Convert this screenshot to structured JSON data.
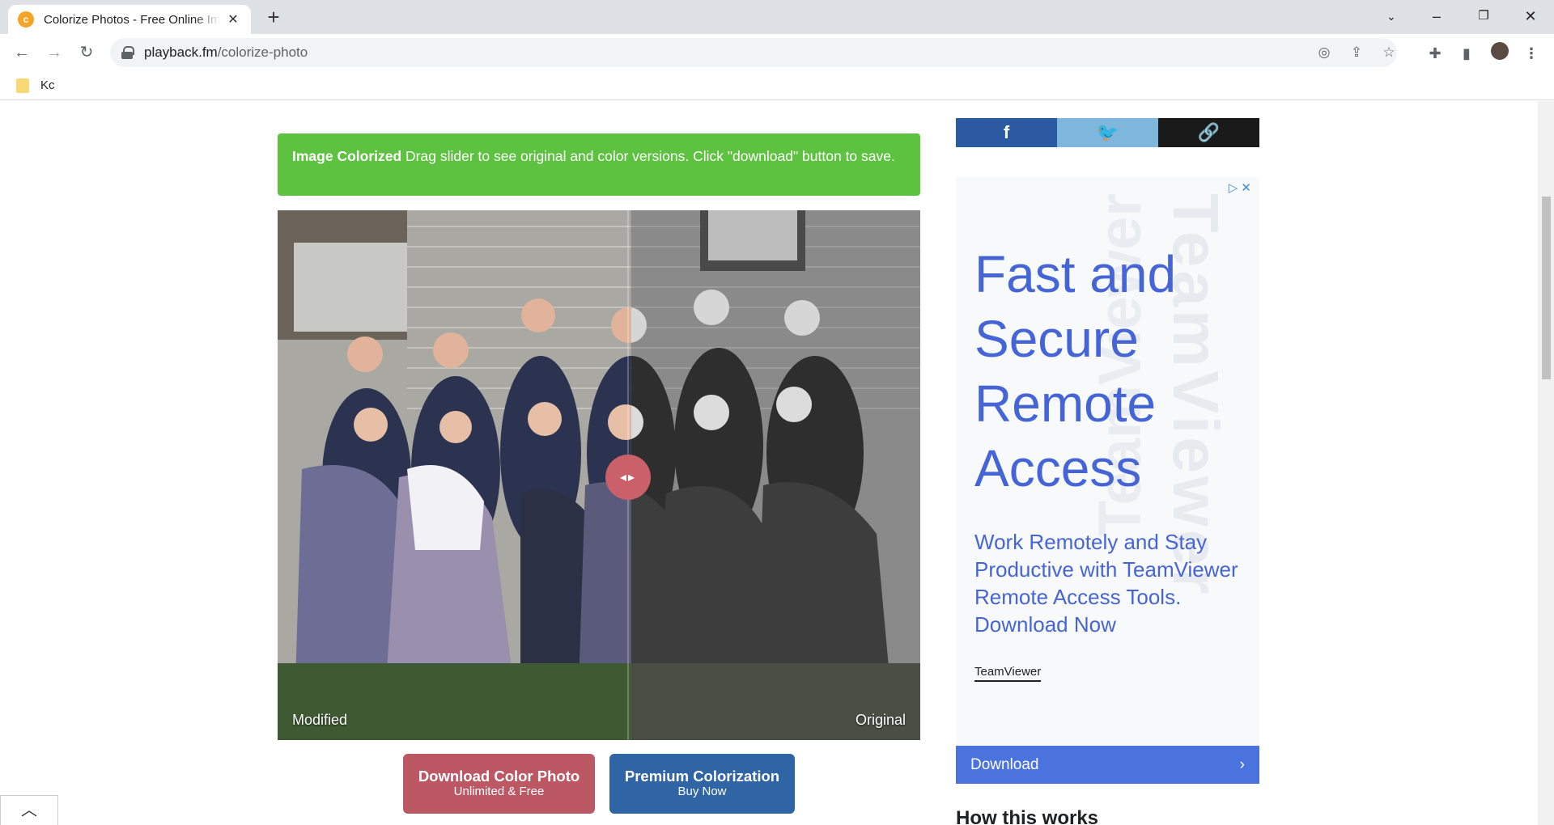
{
  "browser": {
    "tab_title": "Colorize Photos - Free Online Image Colorizer",
    "tab_favicon_glyph": "c",
    "url_host": "playback.fm",
    "url_path": "/colorize-photo",
    "bookmark_folder": "Kc"
  },
  "alert": {
    "bold": "Image Colorized",
    "text": " Drag slider to see original and color versions. Click \"download\" button to save."
  },
  "compare": {
    "left_label": "Modified",
    "right_label": "Original",
    "slider_position": 0.55
  },
  "buttons": {
    "download_main": "Download Color Photo",
    "download_sub": "Unlimited & Free",
    "premium_main": "Premium Colorization",
    "premium_sub": "Buy Now"
  },
  "share": {
    "facebook_glyph": "f",
    "twitter_glyph": "🐦",
    "link_glyph": "🔗"
  },
  "ad": {
    "headline": "Fast and Secure Remote Access",
    "body": "Work Remotely and Stay Productive with TeamViewer Remote Access Tools. Download Now",
    "brand": "TeamViewer",
    "cta": "Download",
    "watermark": "TeamViewer"
  },
  "section_heading": "How this works",
  "colors": {
    "alert_green": "#5cc23f",
    "download_red": "#bc5863",
    "premium_blue": "#2f64a5",
    "ad_blue": "#4565d6"
  }
}
